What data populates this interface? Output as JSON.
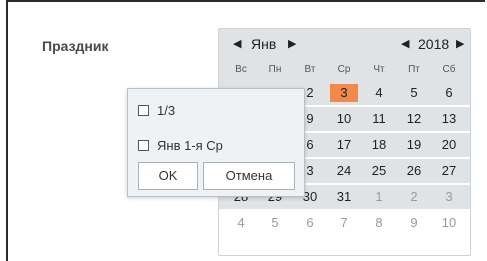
{
  "field": {
    "label": "Праздник"
  },
  "calendar": {
    "month": "Янв",
    "year": "2018",
    "weekdays": [
      "Вс",
      "Пн",
      "Вт",
      "Ср",
      "Чт",
      "Пт",
      "Сб"
    ],
    "weeks": [
      [
        "",
        "",
        "2",
        "3",
        "4",
        "5",
        "6"
      ],
      [
        "",
        "",
        "9",
        "10",
        "11",
        "12",
        "13"
      ],
      [
        "",
        "",
        "6",
        "17",
        "18",
        "19",
        "20"
      ],
      [
        "",
        "",
        "3",
        "24",
        "25",
        "26",
        "27"
      ],
      [
        "28",
        "29",
        "30",
        "31",
        "1",
        "2",
        "3"
      ],
      [
        "4",
        "5",
        "6",
        "7",
        "8",
        "9",
        "10"
      ]
    ],
    "today": "3",
    "today_color": "#f4884b"
  },
  "popup": {
    "option_1": "1/3",
    "option_2": "Янв 1-я Ср",
    "ok_label": "OK",
    "cancel_label": "Отмена"
  }
}
